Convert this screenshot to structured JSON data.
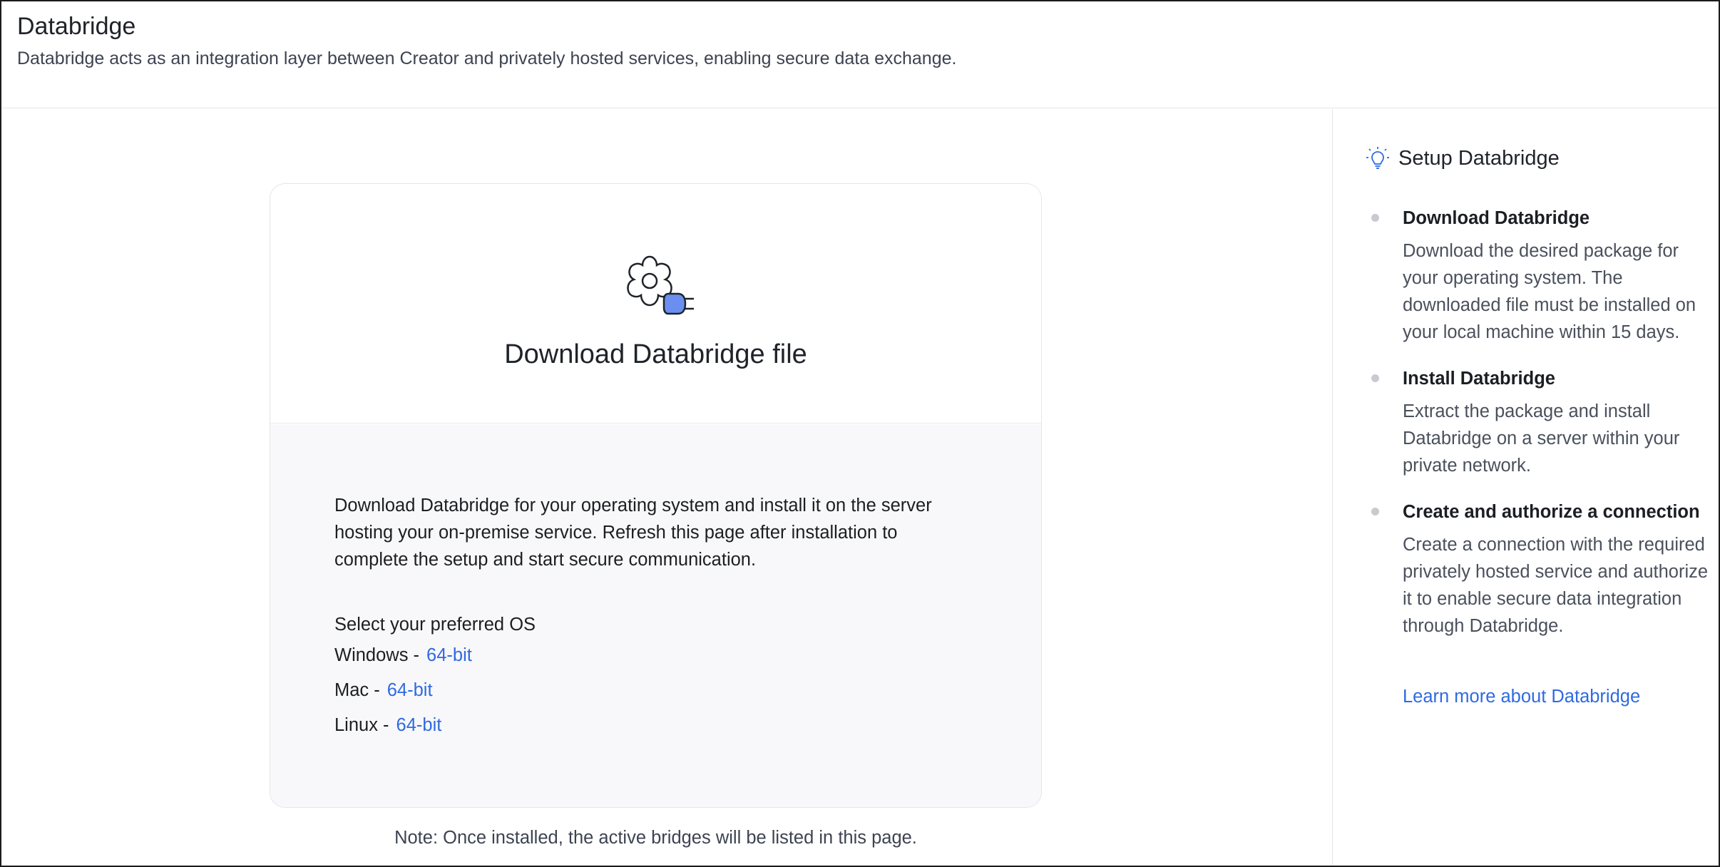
{
  "header": {
    "title": "Databridge",
    "description": "Databridge acts as an integration layer between Creator and privately hosted services, enabling secure data exchange."
  },
  "card": {
    "icon": "gear-plug-icon",
    "title": "Download Databridge file",
    "description": "Download Databridge for your operating system and install it on the server hosting your on-premise service. Refresh this page after installation to complete the setup and start secure communication.",
    "os_heading": "Select your preferred OS",
    "os_options": [
      {
        "os": "Windows -",
        "link": "64-bit"
      },
      {
        "os": "Mac -",
        "link": "64-bit"
      },
      {
        "os": "Linux -",
        "link": "64-bit"
      }
    ]
  },
  "note": "Note: Once installed, the active bridges will be listed in this page.",
  "sidebar": {
    "icon": "lightbulb-icon",
    "title": "Setup Databridge",
    "steps": [
      {
        "title": "Download Databridge",
        "description": "Download the desired package for your operating system. The downloaded file must be installed on your local machine within 15 days."
      },
      {
        "title": "Install Databridge",
        "description": "Extract the package and install Databridge on a server within your private network."
      },
      {
        "title": "Create and authorize a connection",
        "description": "Create a connection with the required privately hosted service and authorize it to enable secure data integration through Databridge."
      }
    ],
    "learn_more": "Learn more about Databridge"
  },
  "colors": {
    "link": "#2f6ae0",
    "accent_plug": "#6b8ff0",
    "card_bottom_bg": "#f8f8fa"
  }
}
